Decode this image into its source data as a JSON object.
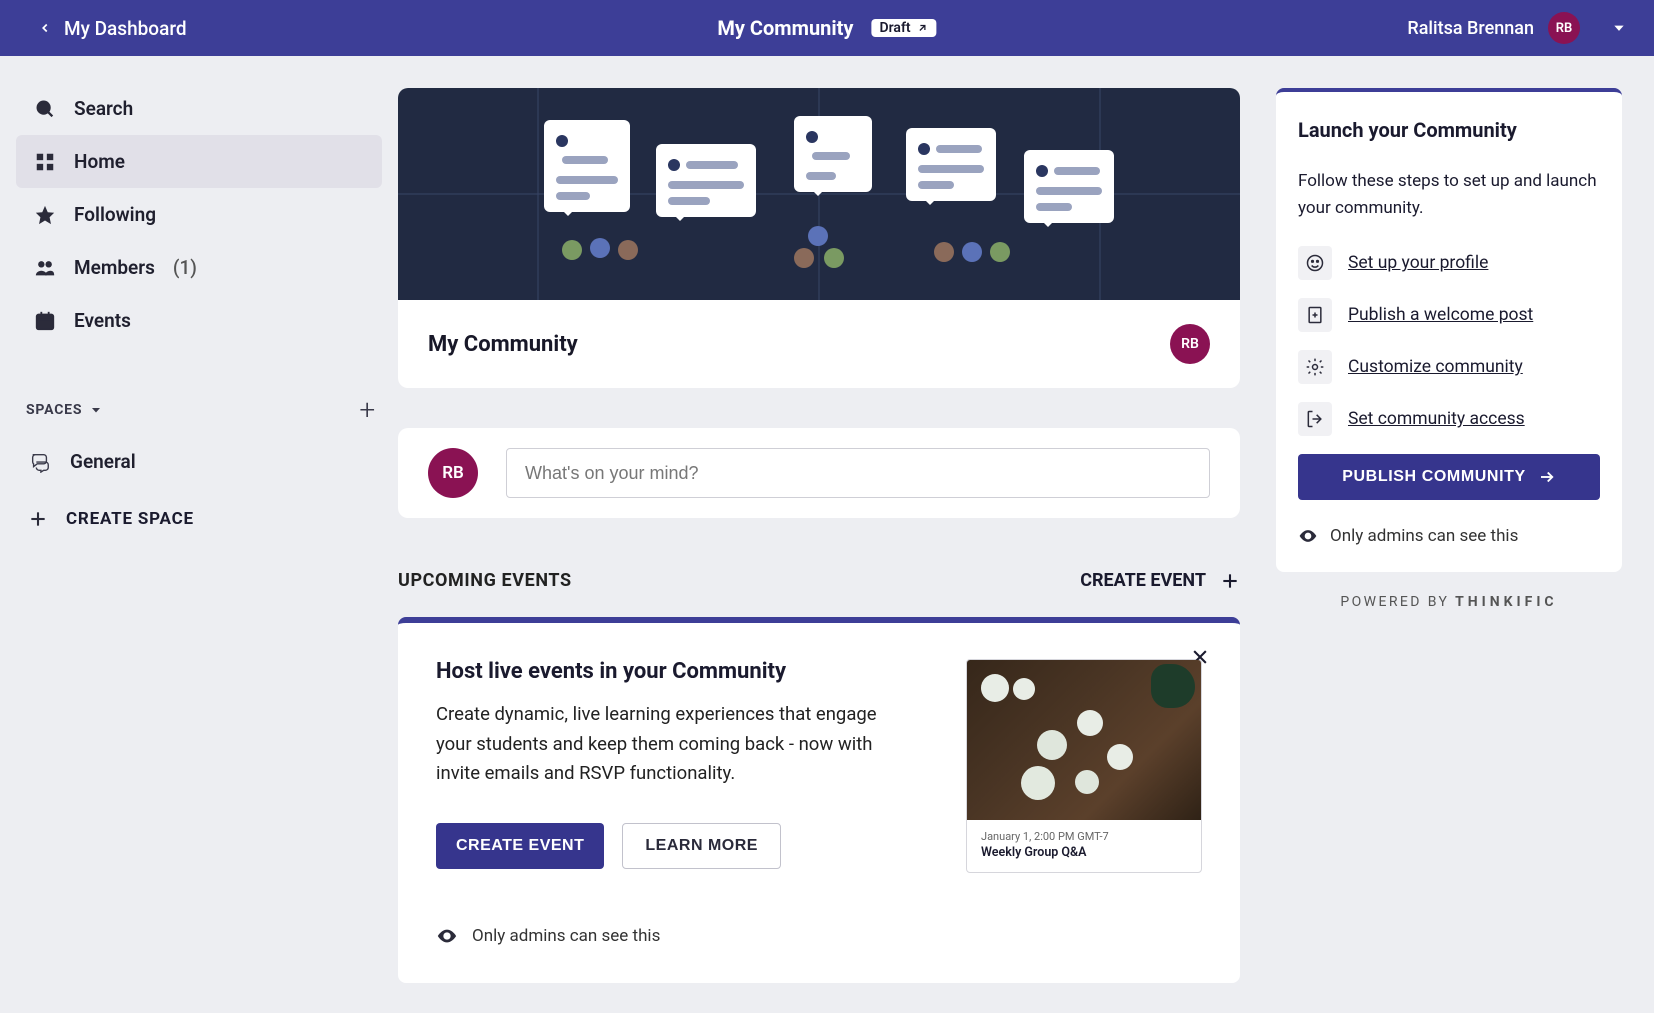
{
  "topbar": {
    "back_label": "My Dashboard",
    "center_title": "My Community",
    "draft_label": "Draft",
    "user_name": "Ralitsa Brennan",
    "user_initials": "RB"
  },
  "sidebar": {
    "items": [
      {
        "icon": "search",
        "label": "Search"
      },
      {
        "icon": "grid",
        "label": "Home",
        "active": true
      },
      {
        "icon": "star",
        "label": "Following"
      },
      {
        "icon": "people",
        "label": "Members",
        "count": "(1)"
      },
      {
        "icon": "calendar",
        "label": "Events"
      }
    ],
    "spaces_header": "SPACES",
    "spaces": [
      {
        "label": "General"
      }
    ],
    "create_space": "CREATE SPACE"
  },
  "hero": {
    "title": "My Community",
    "avatar_initials": "RB"
  },
  "composer": {
    "avatar_initials": "RB",
    "placeholder": "What's on your mind?"
  },
  "events": {
    "header_label": "UPCOMING EVENTS",
    "create_label": "CREATE EVENT",
    "promo_title": "Host live events in your Community",
    "promo_body": "Create dynamic, live learning experiences that engage your students and keep them coming back - now with invite emails and RSVP functionality.",
    "btn_create": "CREATE EVENT",
    "btn_learn": "LEARN MORE",
    "admin_note": "Only admins can see this",
    "preview": {
      "date": "January 1, 2:00 PM GMT-7",
      "title": "Weekly Group Q&A"
    }
  },
  "launch": {
    "title": "Launch your Community",
    "subtitle": "Follow these steps to set up and launch your community.",
    "steps": [
      {
        "icon": "smile",
        "label": "Set up your profile"
      },
      {
        "icon": "doc-plus",
        "label": "Publish a welcome post"
      },
      {
        "icon": "gear",
        "label": "Customize community"
      },
      {
        "icon": "exit",
        "label": "Set community access"
      }
    ],
    "publish_label": "PUBLISH COMMUNITY",
    "admin_note": "Only admins can see this"
  },
  "footer": {
    "powered_prefix": "POWERED BY",
    "powered_brand": "THINKIFIC"
  }
}
